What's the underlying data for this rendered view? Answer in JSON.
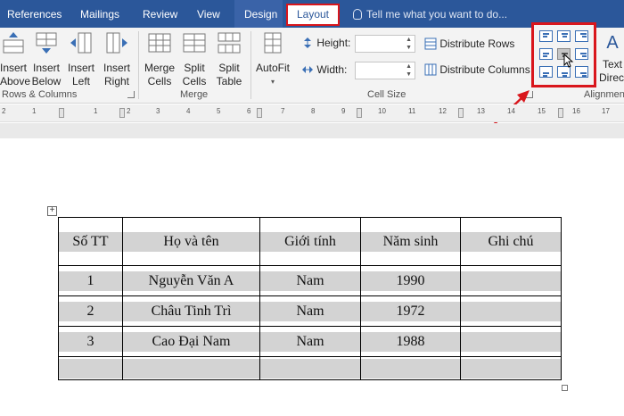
{
  "tabs": {
    "references": "References",
    "mailings": "Mailings",
    "review": "Review",
    "view": "View",
    "design": "Design",
    "layout": "Layout",
    "tell_me": "Tell me what you want to do..."
  },
  "ribbon": {
    "rows_columns": {
      "insert_above": [
        "Insert",
        "Above"
      ],
      "insert_below": [
        "Insert",
        "Below"
      ],
      "insert_left": [
        "Insert",
        "Left"
      ],
      "insert_right": [
        "Insert",
        "Right"
      ],
      "label": "Rows & Columns"
    },
    "merge": {
      "merge_cells": [
        "Merge",
        "Cells"
      ],
      "split_cells": [
        "Split",
        "Cells"
      ],
      "split_table": [
        "Split",
        "Table"
      ],
      "label": "Merge"
    },
    "cell_size": {
      "autofit": "AutoFit",
      "height_label": "Height:",
      "width_label": "Width:",
      "height_value": "",
      "width_value": "",
      "distribute_rows": "Distribute Rows",
      "distribute_columns": "Distribute Columns",
      "label": "Cell Size"
    },
    "alignment": {
      "text_direction": [
        "Text",
        "Directi"
      ],
      "label": "Alignmen"
    }
  },
  "ruler": {
    "numbers": [
      "2",
      "1",
      "1",
      "2",
      "3",
      "4",
      "5",
      "6",
      "7",
      "8",
      "9",
      "10",
      "11",
      "12",
      "13",
      "14",
      "15",
      "16",
      "17"
    ]
  },
  "table": {
    "header": [
      "Số TT",
      "Họ và tên",
      "Giới tính",
      "Năm sinh",
      "Ghi chú"
    ],
    "rows": [
      [
        "1",
        "Nguyễn Văn A",
        "Nam",
        "1990",
        ""
      ],
      [
        "2",
        "Châu Tinh Trì",
        "Nam",
        "1972",
        ""
      ],
      [
        "3",
        "Cao Đại Nam",
        "Nam",
        "1988",
        ""
      ],
      [
        "",
        "",
        "",
        "",
        ""
      ]
    ]
  },
  "colors": {
    "ribbon_blue": "#2b579a",
    "highlight_red": "#d9161c",
    "cell_shading": "#d3d3d3"
  }
}
